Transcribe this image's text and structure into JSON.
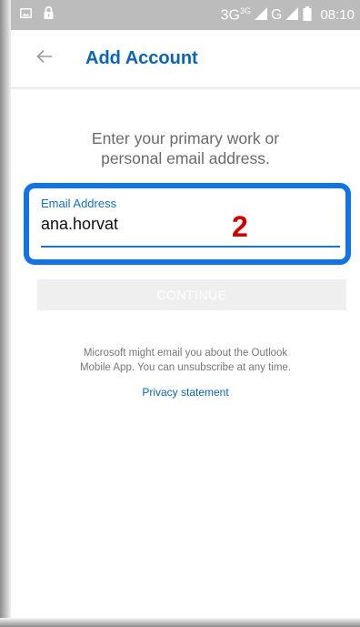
{
  "status_bar": {
    "network": "3G",
    "network_sup": "3G",
    "network2": "G",
    "time": "08:10",
    "icons": [
      "image-icon",
      "lock-icon",
      "signal-icon",
      "signal-icon-2",
      "battery-icon"
    ],
    "color": "#bcbcbc"
  },
  "app_bar": {
    "back_icon": "arrow-left-icon",
    "title": "Add Account",
    "title_color": "#0a64b8"
  },
  "main": {
    "prompt_line1": "Enter your primary work or",
    "prompt_line2": "personal email address.",
    "email": {
      "label": "Email Address",
      "value": "ana.horvat",
      "highlight_color": "#1273e6"
    },
    "annotation_number": "2",
    "continue_label": "CONTINUE",
    "disclaimer_line1": "Microsoft might email you about the Outlook",
    "disclaimer_line2": "Mobile App. You can unsubscribe at any time.",
    "privacy_label": "Privacy statement"
  }
}
